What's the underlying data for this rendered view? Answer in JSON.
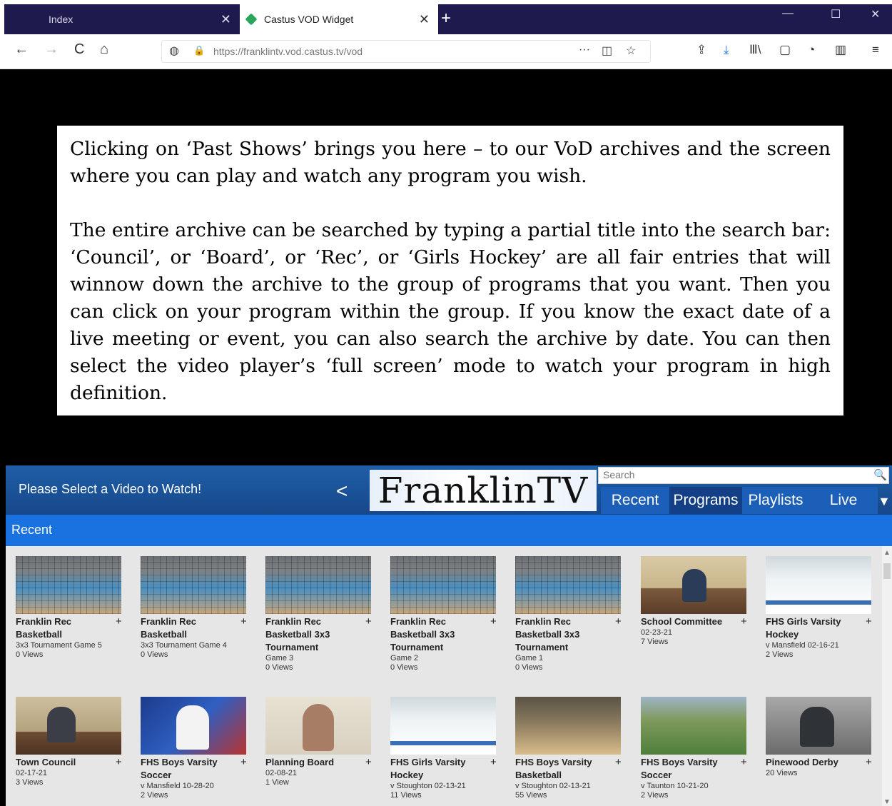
{
  "browser": {
    "tabs": [
      {
        "label": "Index",
        "close": "✕"
      },
      {
        "label": "Castus VOD Widget",
        "close": "✕"
      }
    ],
    "new_tab": "+",
    "window_controls": {
      "minimize": "—",
      "maximize": "☐",
      "close": "✕"
    },
    "url": "https://franklintv.vod.castus.tv/vod",
    "nav": {
      "back": "←",
      "forward": "→",
      "reload": "C",
      "home": "⌂"
    },
    "url_icons": {
      "shield": "◍",
      "lock": "🔒"
    },
    "url_actions": {
      "more": "···",
      "pocket": "◫",
      "bookmark": "☆"
    },
    "toolbar": {
      "downloads_tray": "⇪",
      "download": "⤓",
      "library": "Ⅲ\\",
      "reader": "▢",
      "ext": "◔",
      "grid": "▥",
      "menu": "≡"
    }
  },
  "overlay": {
    "paragraph1": "Clicking on ‘Past Shows’ brings you here – to our VoD archives and the screen where you can play and watch any program you wish.",
    "paragraph2": "The entire archive can be searched by typing a partial title into the search bar: ‘Council’, or ‘Board’, or ‘Rec’, or ‘Girls Hockey’ are all fair entries that will winnow down the archive to the group of programs that you want. Then you can click on your program within the group. If you know the exact date of a live meeting or event, you can also search the archive by date. You can then select the video player’s ‘full screen’ mode to watch your program in high definition."
  },
  "widget": {
    "header_text": "Please Select a Video to Watch!",
    "share_icon": "<",
    "logo_text": "FranklinTV",
    "search_placeholder": "Search",
    "search_icon": "🔍",
    "tabs": [
      "Recent",
      "Programs",
      "Playlists",
      "Live"
    ],
    "active_tab": "Recent",
    "dropdown_icon": "▼",
    "section_title": "Recent",
    "plus": "+",
    "row1": [
      {
        "title": "Franklin Rec Basketball",
        "sub": [
          "3x3 Tournament Game 5",
          "0 Views"
        ],
        "thumb": "court"
      },
      {
        "title": "Franklin Rec Basketball",
        "sub": [
          "3x3 Tournament Game 4",
          "0 Views"
        ],
        "thumb": "court"
      },
      {
        "title": "Franklin Rec Basketball 3x3 Tournament",
        "sub": [
          "Game 3",
          "0 Views"
        ],
        "thumb": "court"
      },
      {
        "title": "Franklin Rec Basketball 3x3 Tournament",
        "sub": [
          "Game 2",
          "0 Views"
        ],
        "thumb": "court"
      },
      {
        "title": "Franklin Rec Basketball 3x3 Tournament",
        "sub": [
          "Game 1",
          "0 Views"
        ],
        "thumb": "court"
      },
      {
        "title": "School Committee",
        "sub": [
          "02-23-21",
          "7 Views"
        ],
        "thumb": "office"
      },
      {
        "title": "FHS Girls Varsity Hockey",
        "sub": [
          "v Mansfield 02-16-21",
          "2 Views"
        ],
        "thumb": "rink"
      }
    ],
    "row2": [
      {
        "title": "Town Council",
        "sub": [
          "02-17-21",
          "3 Views"
        ],
        "thumb": "council"
      },
      {
        "title": "FHS Boys Varsity Soccer",
        "sub": [
          "v Mansfield 10-28-20",
          "2 Views"
        ],
        "thumb": "soccerposter"
      },
      {
        "title": "Planning Board",
        "sub": [
          "02-08-21",
          "1 View"
        ],
        "thumb": "planning"
      },
      {
        "title": "FHS Girls Varsity Hockey",
        "sub": [
          "v Stoughton 02-13-21",
          "11 Views"
        ],
        "thumb": "rink"
      },
      {
        "title": "FHS Boys Varsity Basketball",
        "sub": [
          "v Stoughton 02-13-21",
          "55 Views"
        ],
        "thumb": "gym"
      },
      {
        "title": "FHS Boys Varsity Soccer",
        "sub": [
          "v Taunton 10-21-20",
          "2 Views"
        ],
        "thumb": "field"
      },
      {
        "title": "Pinewood Derby",
        "sub": [
          "20 Views"
        ],
        "thumb": "derby"
      }
    ]
  }
}
